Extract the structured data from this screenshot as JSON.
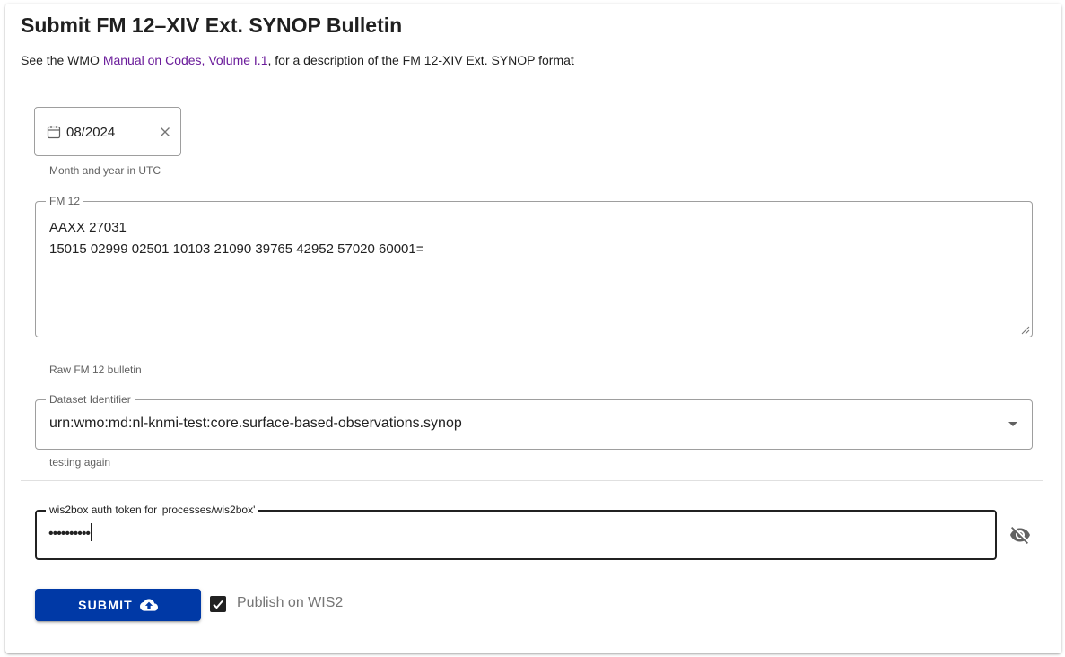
{
  "page": {
    "title": "Submit FM 12–XIV Ext. SYNOP Bulletin",
    "subtitle_before": "See the WMO ",
    "subtitle_link": "Manual on Codes, Volume I.1",
    "subtitle_after": ", for a description of the FM 12-XIV Ext. SYNOP format"
  },
  "date_field": {
    "icon": "calendar-icon",
    "value": "08/2024",
    "clear_icon": "close-icon",
    "hint": "Month and year in UTC"
  },
  "fm12_field": {
    "label": "FM 12",
    "value": "AAXX 27031\n15015 02999 02501 10103 21090 39765 42952 57020 60001=",
    "hint": "Raw FM 12 bulletin"
  },
  "dataset_field": {
    "label": "Dataset Identifier",
    "value": "urn:wmo:md:nl-knmi-test:core.surface-based-observations.synop",
    "hint": "testing again",
    "icon": "chevron-down-icon"
  },
  "token_field": {
    "label": "wis2box auth token for 'processes/wis2box'",
    "value": "••••••••••",
    "visibility_icon": "eye-off-icon"
  },
  "actions": {
    "submit_label": "SUBMIT",
    "submit_icon": "cloud-upload-icon",
    "publish_label": "Publish on WIS2",
    "publish_checked": true
  },
  "colors": {
    "primary": "#0039a6",
    "link": "#6a1b9a",
    "checkbox": "#212121"
  }
}
